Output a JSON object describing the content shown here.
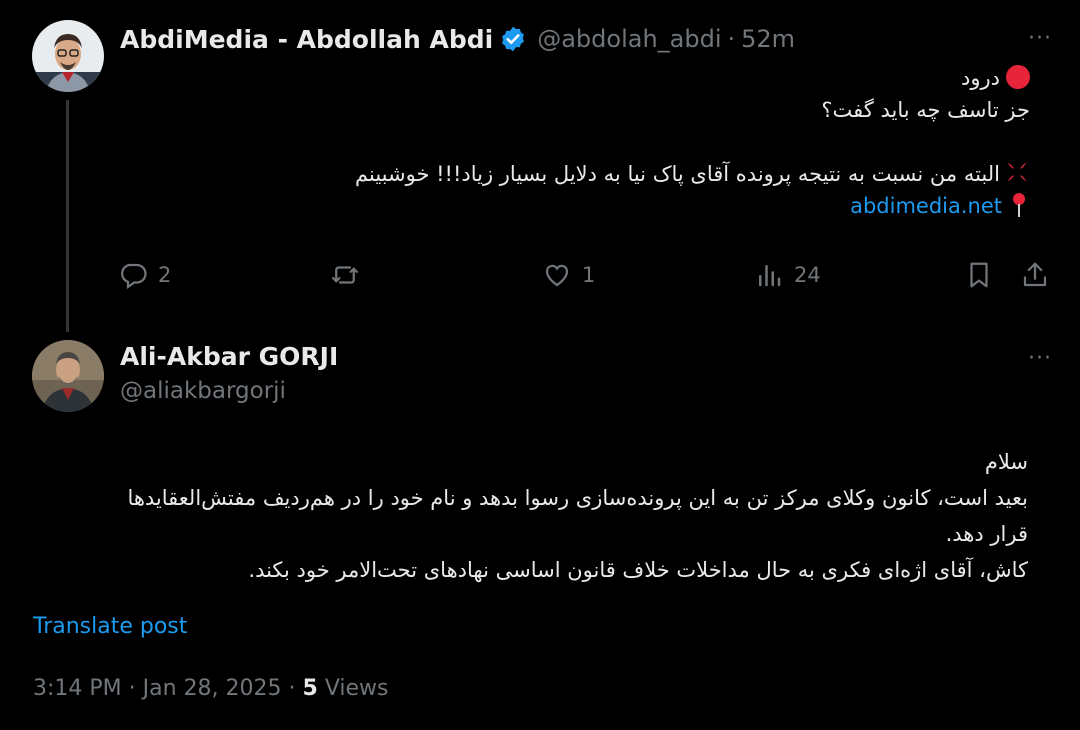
{
  "tweet1": {
    "author_name": "AbdiMedia - Abdollah Abdi",
    "handle": "@abdolah_abdi",
    "separator": "·",
    "time": "52m",
    "more_label": "···",
    "lines": {
      "greeting": "درود",
      "line2": "جز تاسف چه باید گفت؟",
      "line3": "البته من نسبت به نتیجه پرونده آقای پاک نیا به دلایل بسیار زیاد!!! خوشبینم",
      "link": "abdimedia.net"
    },
    "actions": {
      "replies": "2",
      "reposts": "",
      "likes": "1",
      "views": "24"
    }
  },
  "tweet2": {
    "author_name": "Ali-Akbar GORJI",
    "handle": "@aliakbargorji",
    "more_label": "···",
    "lines": [
      "سلام",
      "بعید است، کانون وکلای مرکز تن به این پرونده‌سازی رسوا بدهد و نام خود را در هم‌ردیف مفتش‌العقایدها",
      "قرار دهد.",
      "کاش، آقای اژه‌ای فکری به حال مداخلات خلاف قانون اساسی نهادهای تحت‌الامر خود بکند."
    ],
    "translate_label": "Translate post",
    "footer": {
      "time": "3:14 PM",
      "sep1": "·",
      "date": "Jan 28, 2025",
      "sep2": "·",
      "views_count": "5",
      "views_label": "Views"
    }
  },
  "colors": {
    "background": "#000000",
    "text": "#e7e9ea",
    "muted": "#71767b",
    "accent": "#1d9bf0"
  },
  "icons": [
    "verified-badge-icon",
    "more-icon",
    "reply-icon",
    "repost-icon",
    "like-icon",
    "views-icon",
    "bookmark-icon",
    "share-icon",
    "red-circle-emoji",
    "anger-emoji",
    "pin-emoji"
  ]
}
